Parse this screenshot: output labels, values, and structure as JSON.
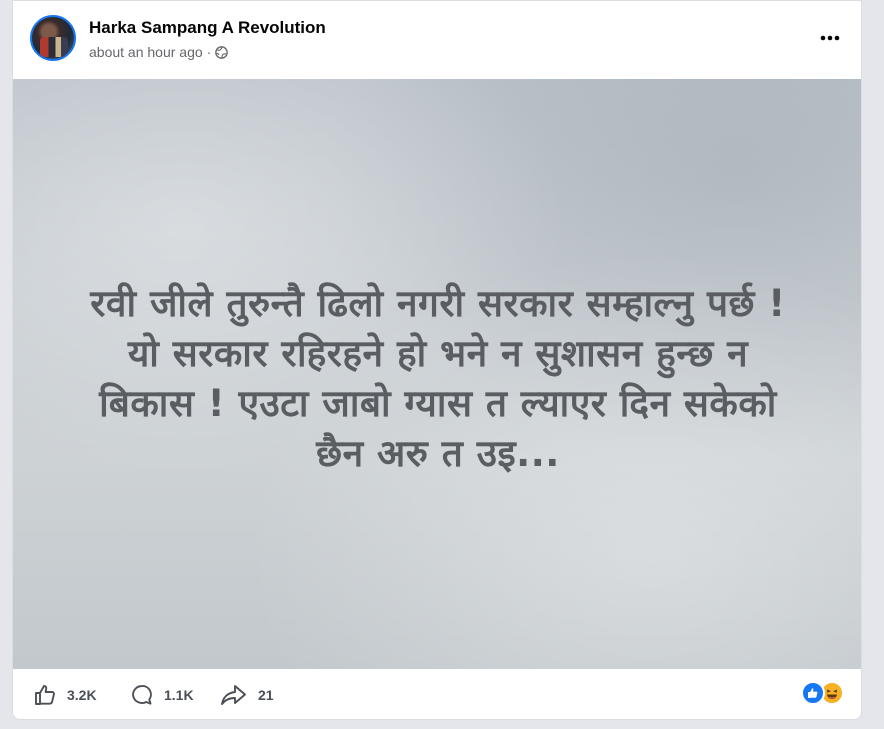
{
  "post": {
    "page_name": "Harka Sampang A Revolution",
    "time": "about an hour ago",
    "separator": "·",
    "text_lines": [
      "रवी जीले तुरुन्तै ढिलो नगरी सरकार सम्हाल्नु पर्छ !",
      "यो सरकार रहिरहने हो भने न सुशासन हुन्छ न",
      "बिकास ! एउटा जाबो ग्यास त ल्याएर दिन सकेको",
      "छैन अरु त उइ..."
    ]
  },
  "footer": {
    "likes": "3.2K",
    "comments": "1.1K",
    "shares": "21"
  },
  "icons": {
    "more": "more-horizontal-icon",
    "privacy": "globe-icon",
    "like": "like-icon",
    "comment": "comment-icon",
    "share": "share-icon"
  },
  "colors": {
    "accent": "#1877f2",
    "haha": "#f7b125",
    "text_muted": "#65676b"
  }
}
